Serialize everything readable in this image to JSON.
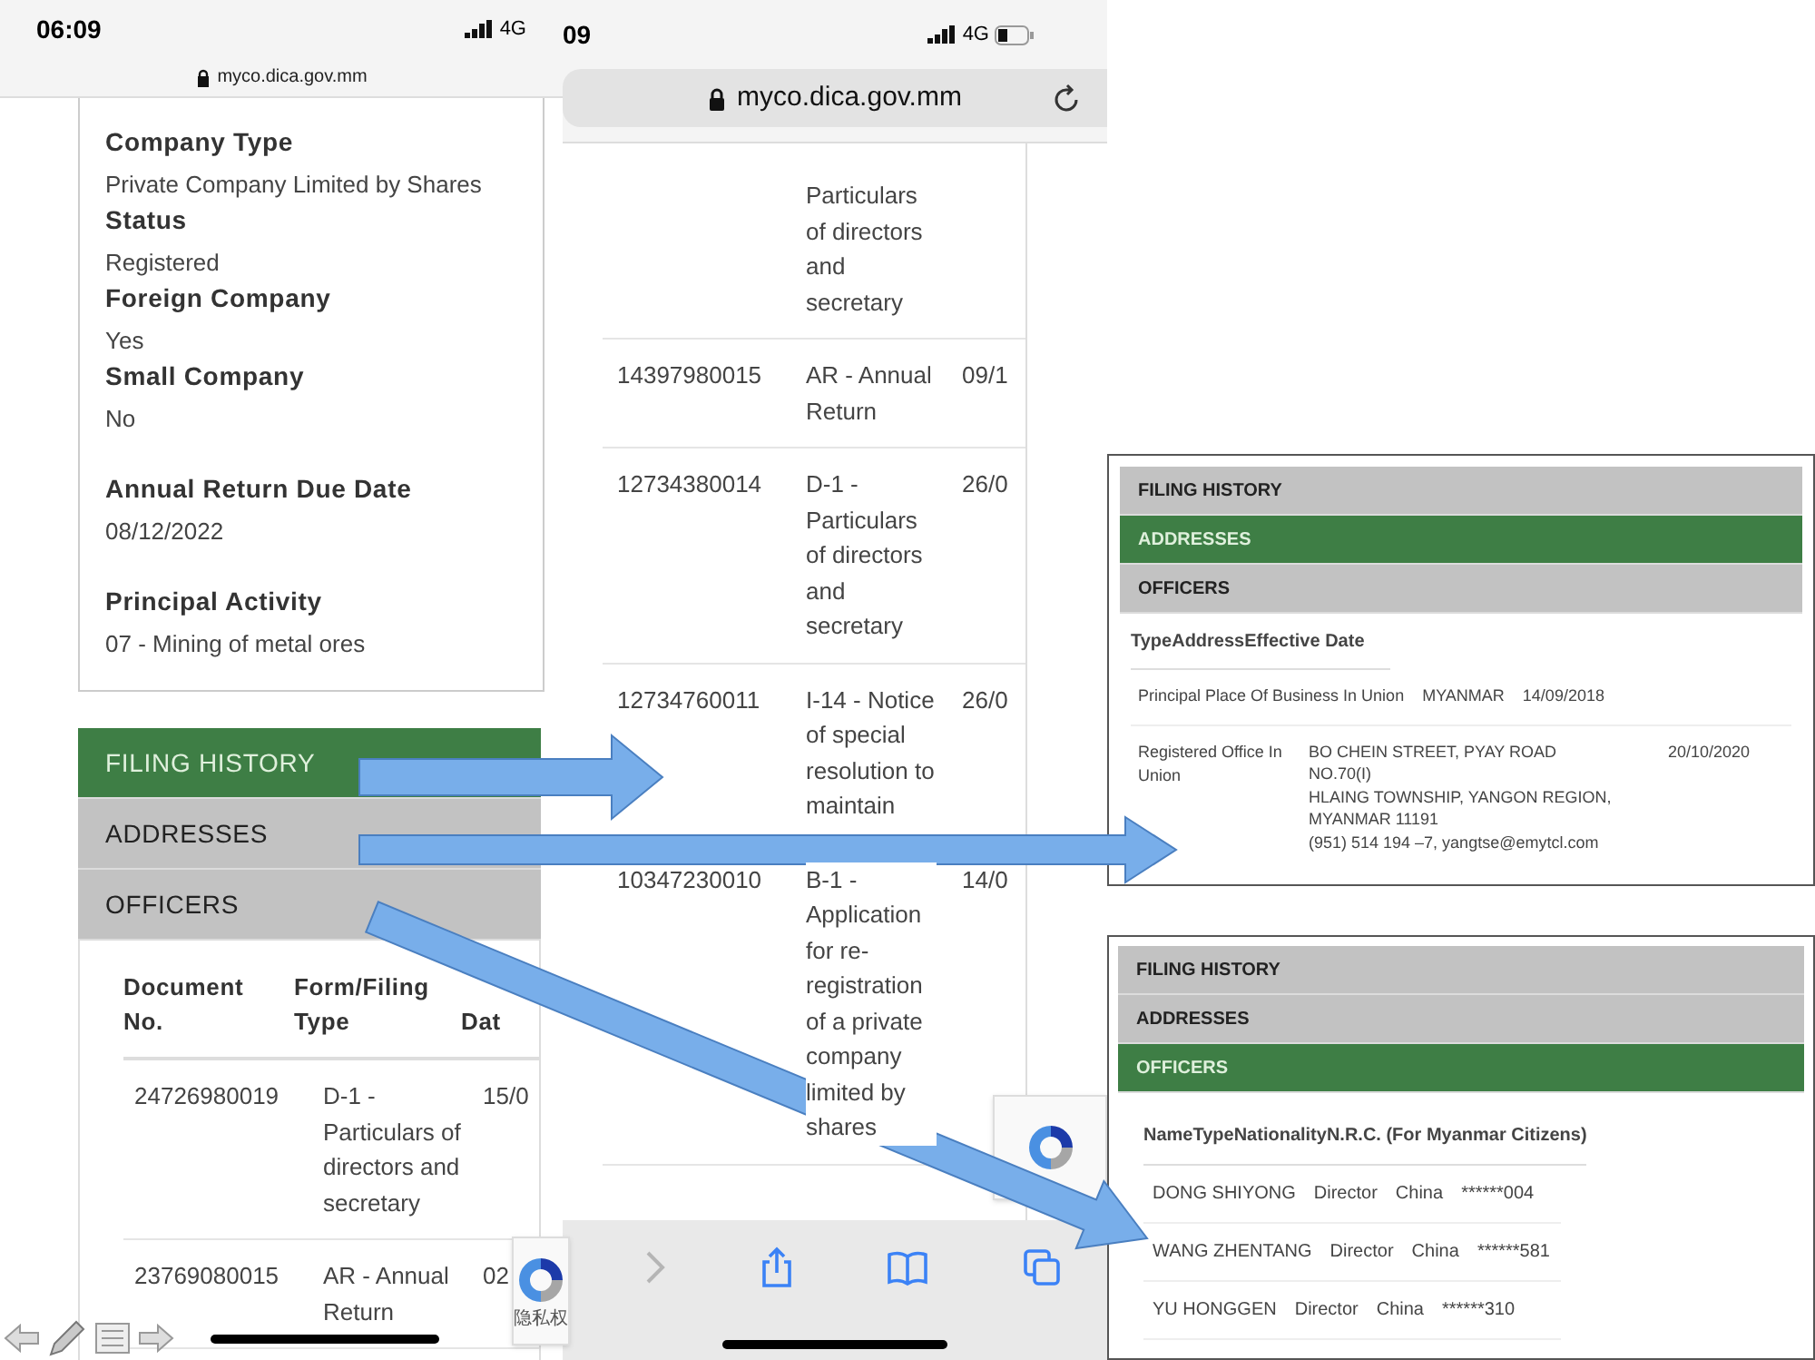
{
  "left_screen": {
    "status_bar": {
      "time": "06:09",
      "network": "4G"
    },
    "url": "myco.dica.gov.mm",
    "details": [
      {
        "label": "Company Type",
        "value": "Private Company Limited by Shares"
      },
      {
        "label": "Status",
        "value": "Registered"
      },
      {
        "label": "Foreign Company",
        "value": "Yes"
      },
      {
        "label": "Small Company",
        "value": "No"
      },
      {
        "label": "Annual Return Due Date",
        "value": "08/12/2022"
      },
      {
        "label": "Principal Activity",
        "value": "07 - Mining of metal ores"
      }
    ],
    "tabs": [
      {
        "label": "FILING HISTORY",
        "selected": true
      },
      {
        "label": "ADDRESSES",
        "selected": false
      },
      {
        "label": "OFFICERS",
        "selected": false
      }
    ],
    "table": {
      "columns": [
        "Document No.",
        "Form/Filing Type",
        "Dat"
      ],
      "rows": [
        [
          "24726980019",
          "D-1 - Particulars of directors and secretary",
          "15/0"
        ],
        [
          "23769080015",
          "AR - Annual Return",
          "02"
        ]
      ]
    },
    "recaptcha_text": "隐私权"
  },
  "middle_screen": {
    "status_bar": {
      "time": "09",
      "network": "4G"
    },
    "url": "myco.dica.gov.mm",
    "rows": [
      [
        "",
        "Particulars of directors and secretary",
        ""
      ],
      [
        "14397980015",
        "AR - Annual Return",
        "09/1"
      ],
      [
        "12734380014",
        "D-1 - Particulars of directors and secretary",
        "26/0"
      ],
      [
        "12734760011",
        "I-14 - Notice of special resolution to maintain",
        "26/0"
      ],
      [
        "10347230010",
        "B-1 - Application for re-registration of a private company limited by shares",
        "14/0"
      ]
    ]
  },
  "addresses_screen": {
    "tabs": [
      {
        "label": "FILING HISTORY",
        "selected": false
      },
      {
        "label": "ADDRESSES",
        "selected": true
      },
      {
        "label": "OFFICERS",
        "selected": false
      }
    ],
    "header": "TypeAddressEffective Date",
    "rows": [
      {
        "type": "Principal Place Of Business In Union",
        "address": [
          "MYANMAR"
        ],
        "date": "14/09/2018"
      },
      {
        "type": "Registered Office In Union",
        "address": [
          "BO CHEIN STREET, PYAY ROAD",
          "NO.70(I)",
          "HLAING TOWNSHIP, YANGON REGION,",
          "MYANMAR 11191",
          "(951) 514 194 –7, yangtse@emytcl.com"
        ],
        "date": "20/10/2020"
      }
    ]
  },
  "officers_screen": {
    "tabs": [
      {
        "label": "FILING HISTORY",
        "selected": false
      },
      {
        "label": "ADDRESSES",
        "selected": false
      },
      {
        "label": "OFFICERS",
        "selected": true
      }
    ],
    "header": "NameTypeNationalityN.R.C. (For Myanmar Citizens)",
    "rows": [
      [
        "DONG SHIYONG",
        "Director",
        "China",
        "******004"
      ],
      [
        "WANG ZHENTANG",
        "Director",
        "China",
        "******581"
      ],
      [
        "YU HONGGEN",
        "Director",
        "China",
        "******310"
      ]
    ]
  }
}
